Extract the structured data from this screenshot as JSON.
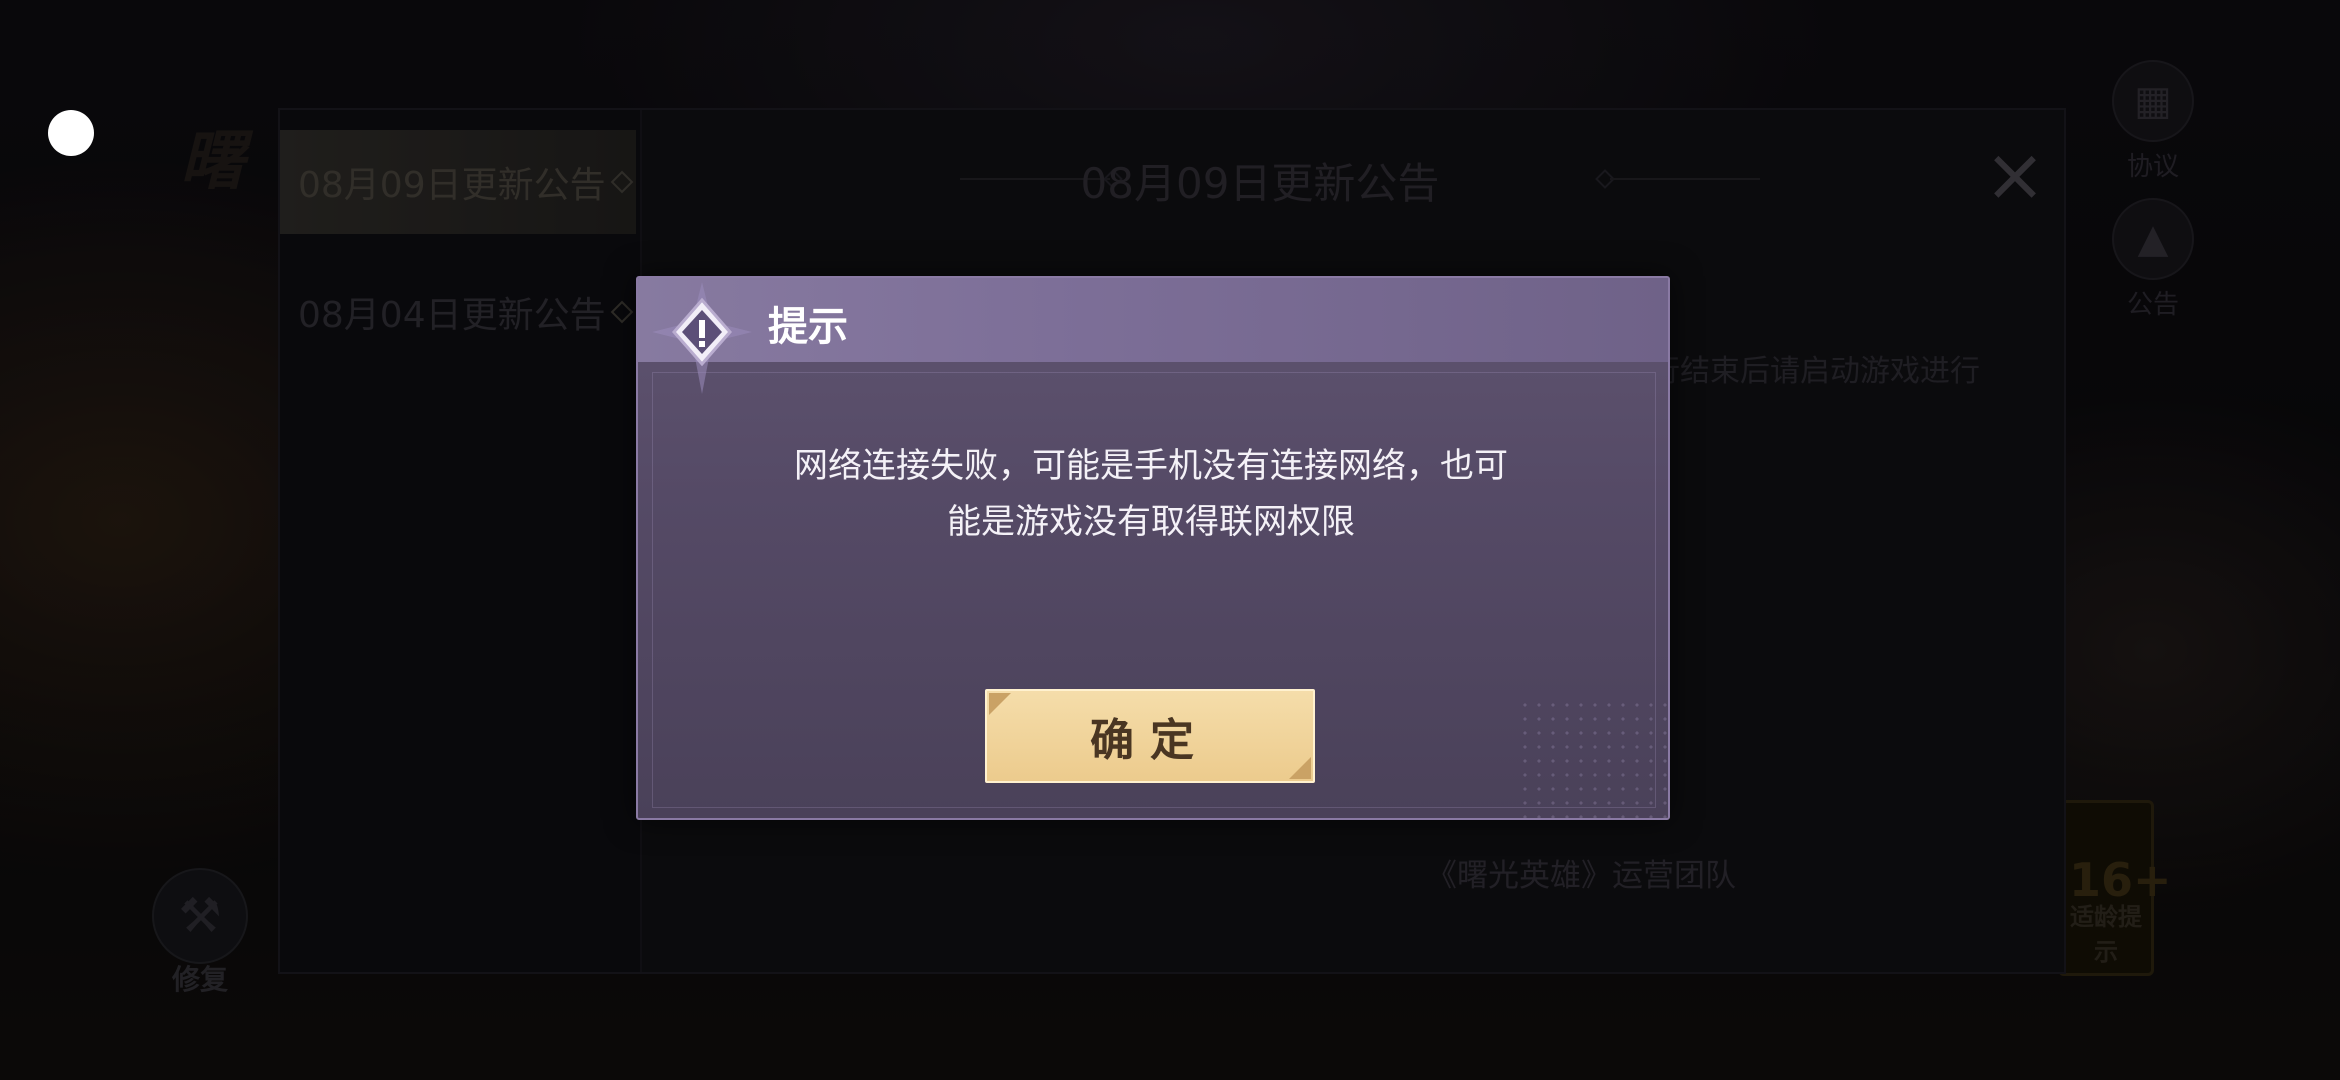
{
  "notice": {
    "tabs": [
      {
        "label": "08月09日更新公告",
        "active": true
      },
      {
        "label": "08月04日更新公告",
        "active": false
      }
    ],
    "title": "08月09日更新公告",
    "body_fragment": "行结束后请启动游戏进行",
    "signature": "《曙光英雄》运营团队"
  },
  "side": {
    "agreement_label": "协议",
    "announcement_label": "公告",
    "repair_label": "修复",
    "age_rating": "16+",
    "age_tip_label": "适龄提示"
  },
  "dialog": {
    "title": "提示",
    "message_lines": [
      "网络连接失败，可能是手机没有连接网络，也可",
      "能是游戏没有取得联网权限"
    ],
    "confirm_label": "确定"
  },
  "colors": {
    "dialog_header": "#877aa0",
    "dialog_body": "#554a66",
    "confirm_button": "#eccb8d",
    "confirm_text": "#4a3622"
  }
}
